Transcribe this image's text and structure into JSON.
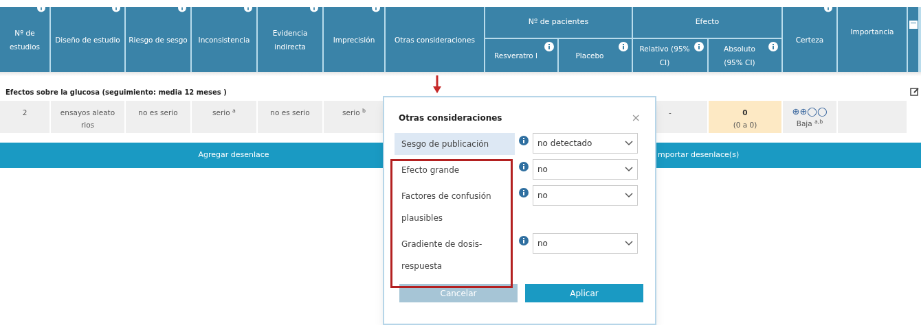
{
  "table": {
    "column_groups": [
      {
        "label": "Nº de pacientes"
      },
      {
        "label": "Efecto"
      }
    ],
    "columns": [
      {
        "label": "Nº de estudios",
        "info": true,
        "grouped": false
      },
      {
        "label": "Diseño de estudio",
        "info": true,
        "grouped": false
      },
      {
        "label": "Riesgo de sesgo",
        "info": true,
        "grouped": false
      },
      {
        "label": "Inconsistencia",
        "info": true,
        "grouped": false
      },
      {
        "label": "Evidencia indirecta",
        "info": true,
        "grouped": false
      },
      {
        "label": "Imprecisión",
        "info": true,
        "grouped": false
      },
      {
        "label": "Otras consideraciones",
        "info": false,
        "grouped": false
      },
      {
        "label": "Resveratro l",
        "info": true,
        "grouped": true
      },
      {
        "label": "Placebo",
        "info": true,
        "grouped": true
      },
      {
        "label": "Relativo (95% CI)",
        "info": true,
        "grouped": true
      },
      {
        "label": "Absoluto (95% CI)",
        "info": true,
        "grouped": true
      },
      {
        "label": "Certeza",
        "info": true,
        "grouped": false
      },
      {
        "label": "Importancia",
        "info": false,
        "grouped": false
      }
    ],
    "section_title": "Efectos sobre la glucosa (seguimiento: media 12 meses )",
    "rows": [
      {
        "cells": [
          {
            "text": "2"
          },
          {
            "text": "ensayos aleatorios"
          },
          {
            "text": "no es serio"
          },
          {
            "text": "serio $^{a}$"
          },
          {
            "text": "no es serio"
          },
          {
            "text": "serio $^{b}$"
          },
          null,
          null,
          null,
          {
            "text": "-"
          },
          {
            "text": "0",
            "note": "(0 a 0)",
            "highlighted": true
          },
          {
            "symbol": "⊕⊕◯◯",
            "text": "Baja $^{a,b}$"
          },
          null
        ]
      }
    ]
  },
  "actions": [
    "Agregar desenlace",
    "mportar desenlace(s)"
  ],
  "popup": {
    "title": "Otras consideraciones",
    "close": "×",
    "fields": [
      {
        "label": "Sesgo de publicación",
        "value": "no detectado",
        "highlighted": true
      },
      {
        "label": "Efecto grande",
        "value": "no",
        "highlighted": false
      },
      {
        "label": "Factores de confusión plausibles",
        "value": "no",
        "highlighted": false
      },
      {
        "label": "Gradiente de dosis-respuesta",
        "value": "no",
        "highlighted": false
      }
    ],
    "buttons": [
      {
        "label": "Cancelar",
        "disabled": true
      },
      {
        "label": "Aplicar",
        "disabled": false
      }
    ]
  }
}
